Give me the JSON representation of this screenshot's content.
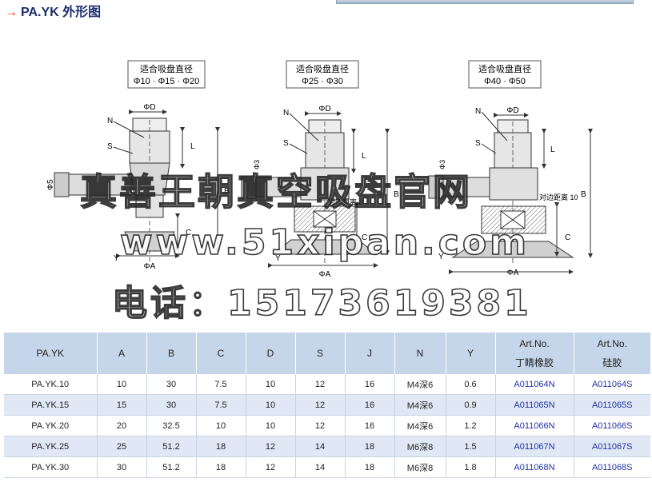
{
  "header": {
    "arrow": "→",
    "title": "PA.YK 外形图"
  },
  "figures": [
    {
      "label_line1": "适合吸盘直径",
      "label_line2": "Φ10 · Φ15 · Φ20"
    },
    {
      "label_line1": "适合吸盘直径",
      "label_line2": "Φ25 · Φ30"
    },
    {
      "label_line1": "适合吸盘直径",
      "label_line2": "Φ40 · Φ50"
    }
  ],
  "dims": {
    "phiD": "ΦD",
    "phiA": "ΦA",
    "phi5": "Φ5",
    "phi3": "Φ3",
    "N": "N",
    "S": "S",
    "L": "L",
    "B": "B",
    "C": "C",
    "Y": "Y",
    "across_flats_2": "对边距离 3",
    "across_flats_3": "对边距离 10"
  },
  "watermark": {
    "line1": "真善王朝真空吸盘官网",
    "line2": "www.51xipan.com",
    "line3": "电话：15173619381"
  },
  "table": {
    "headers": [
      "PA.YK",
      "A",
      "B",
      "C",
      "D",
      "S",
      "J",
      "N",
      "Y",
      [
        "Art.No.",
        "丁睛橡胶"
      ],
      [
        "Art.No.",
        "硅胶"
      ]
    ],
    "rows": [
      [
        "PA.YK.10",
        "10",
        "30",
        "7.5",
        "10",
        "12",
        "16",
        "M4深6",
        "0.6",
        "A011064N",
        "A011064S"
      ],
      [
        "PA.YK.15",
        "15",
        "30",
        "7.5",
        "10",
        "12",
        "16",
        "M4深6",
        "0.9",
        "A011065N",
        "A011065S"
      ],
      [
        "PA.YK.20",
        "20",
        "32.5",
        "10",
        "10",
        "12",
        "16",
        "M4深6",
        "1.2",
        "A011066N",
        "A011066S"
      ],
      [
        "PA.YK.25",
        "25",
        "51.2",
        "18",
        "12",
        "14",
        "18",
        "M6深8",
        "1.5",
        "A011067N",
        "A011067S"
      ],
      [
        "PA.YK.30",
        "30",
        "51.2",
        "18",
        "12",
        "14",
        "18",
        "M6深8",
        "1.8",
        "A011068N",
        "A011068S"
      ]
    ]
  }
}
